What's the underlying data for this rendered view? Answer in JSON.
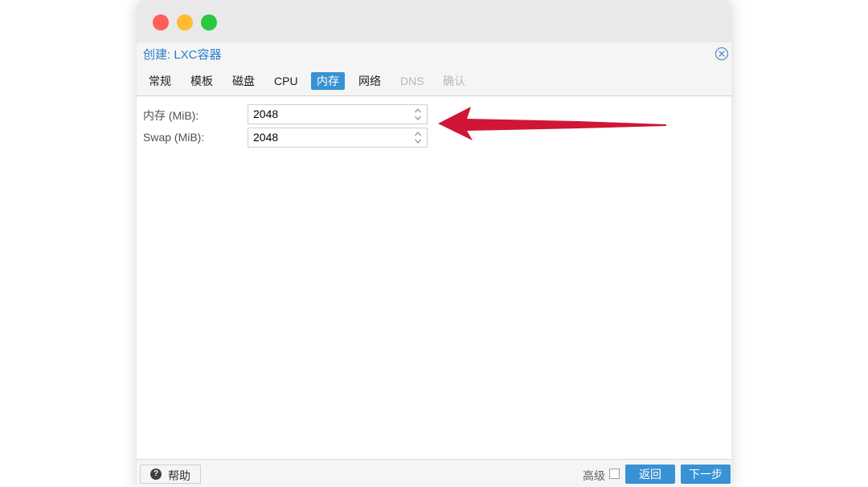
{
  "window": {
    "traffic_lights": [
      "close",
      "minimize",
      "zoom"
    ]
  },
  "dialog": {
    "title": "创建: LXC容器",
    "close_icon": "close-circle-icon"
  },
  "tabs": [
    {
      "label": "常规",
      "state": "normal"
    },
    {
      "label": "模板",
      "state": "normal"
    },
    {
      "label": "磁盘",
      "state": "normal"
    },
    {
      "label": "CPU",
      "state": "normal"
    },
    {
      "label": "内存",
      "state": "active"
    },
    {
      "label": "网络",
      "state": "normal"
    },
    {
      "label": "DNS",
      "state": "disabled"
    },
    {
      "label": "确认",
      "state": "disabled"
    }
  ],
  "form": {
    "memory": {
      "label": "内存 (MiB):",
      "value": "2048"
    },
    "swap": {
      "label": "Swap (MiB):",
      "value": "2048"
    }
  },
  "footer": {
    "help_label": "帮助",
    "advanced_label": "高级",
    "advanced_checked": false,
    "back_label": "返回",
    "next_label": "下一步"
  },
  "colors": {
    "accent": "#3892d4",
    "title": "#2a7ccb",
    "annotation_arrow": "#d01535"
  }
}
